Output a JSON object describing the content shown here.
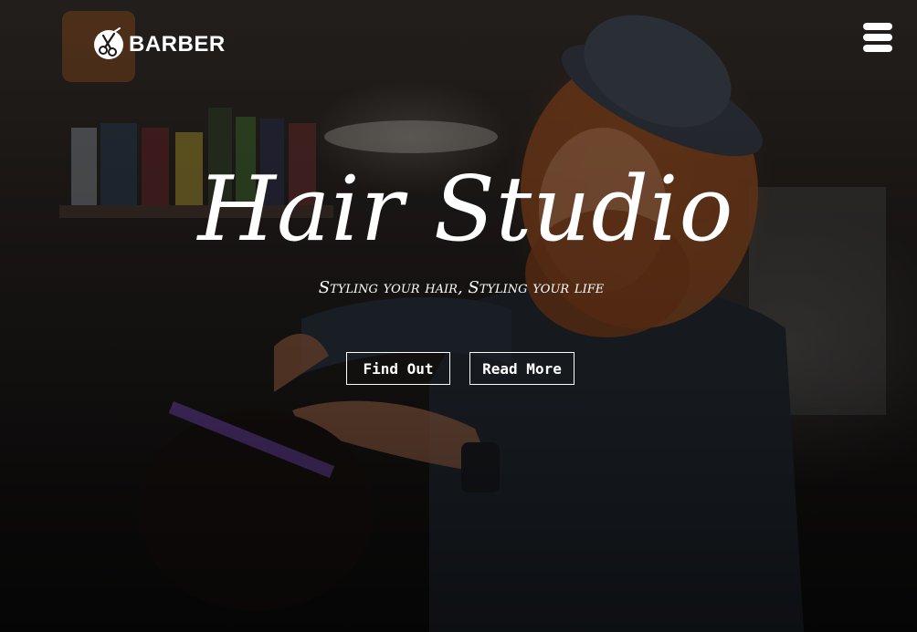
{
  "brand": {
    "name": "BARBER",
    "logo_icon": "scissors-comb-icon"
  },
  "nav": {
    "menu_icon": "hamburger-menu-icon"
  },
  "hero": {
    "title": "Hair Studio",
    "subtitle": "Styling your hair, Styling your life",
    "buttons": [
      {
        "label": "Find Out"
      },
      {
        "label": "Read More"
      }
    ]
  },
  "colors": {
    "text": "#ffffff",
    "accent_hair": "#8a4a22",
    "background": "#0b0a0a"
  }
}
